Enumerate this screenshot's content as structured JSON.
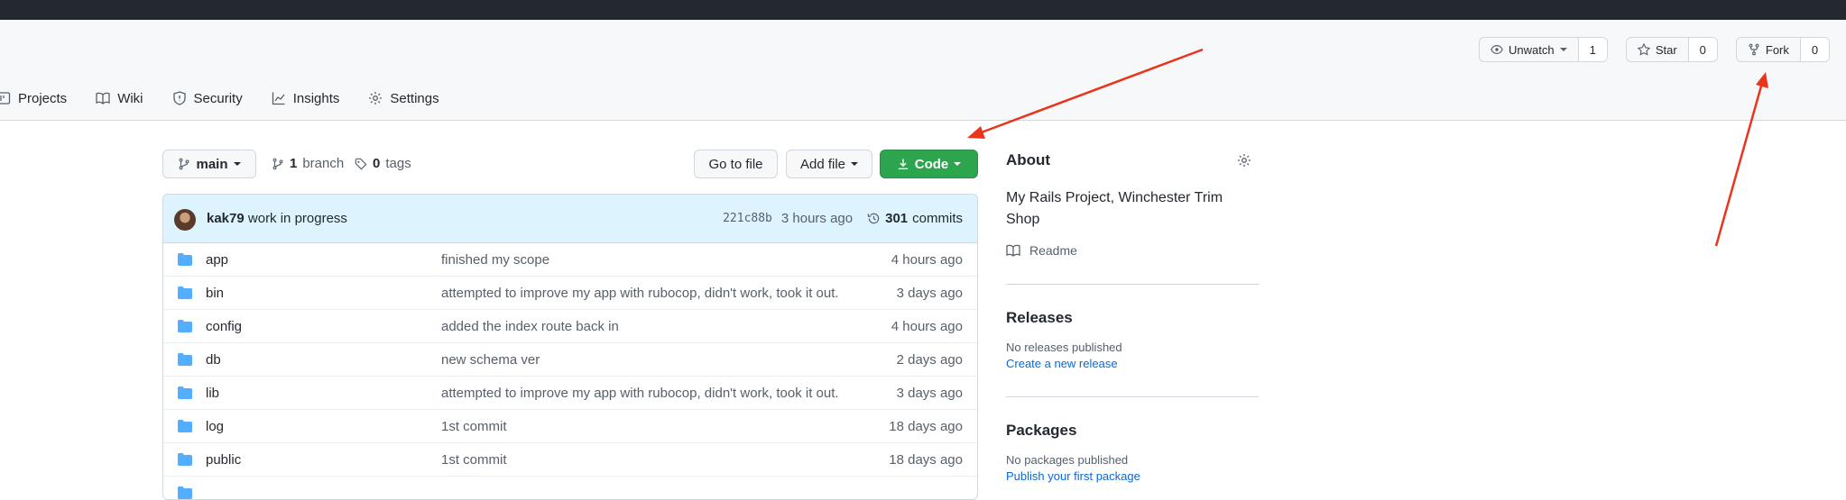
{
  "header": {
    "watch": {
      "label": "Unwatch",
      "count": "1"
    },
    "star": {
      "label": "Star",
      "count": "0"
    },
    "fork": {
      "label": "Fork",
      "count": "0"
    }
  },
  "nav": {
    "items": [
      {
        "label": "Projects",
        "icon": "project-icon"
      },
      {
        "label": "Wiki",
        "icon": "book-icon"
      },
      {
        "label": "Security",
        "icon": "shield-icon"
      },
      {
        "label": "Insights",
        "icon": "graph-icon"
      },
      {
        "label": "Settings",
        "icon": "gear-icon"
      }
    ]
  },
  "toolbar": {
    "branch": "main",
    "branch_count": "1",
    "branch_word": "branch",
    "tag_count": "0",
    "tag_word": "tags",
    "goto_file": "Go to file",
    "add_file": "Add file",
    "code": "Code"
  },
  "commit": {
    "author": "kak79",
    "message": "work in progress",
    "sha": "221c88b",
    "time": "3 hours ago",
    "count": "301",
    "count_word": "commits"
  },
  "files": [
    {
      "name": "app",
      "message": "finished my scope",
      "age": "4 hours ago"
    },
    {
      "name": "bin",
      "message": "attempted to improve my app with rubocop, didn't work, took it out.",
      "age": "3 days ago"
    },
    {
      "name": "config",
      "message": "added the index route back in",
      "age": "4 hours ago"
    },
    {
      "name": "db",
      "message": "new schema ver",
      "age": "2 days ago"
    },
    {
      "name": "lib",
      "message": "attempted to improve my app with rubocop, didn't work, took it out.",
      "age": "3 days ago"
    },
    {
      "name": "log",
      "message": "1st commit",
      "age": "18 days ago"
    },
    {
      "name": "public",
      "message": "1st commit",
      "age": "18 days ago"
    }
  ],
  "about": {
    "title": "About",
    "description": "My Rails Project, Winchester Trim Shop",
    "readme": "Readme"
  },
  "releases": {
    "title": "Releases",
    "empty": "No releases published",
    "link": "Create a new release"
  },
  "packages": {
    "title": "Packages",
    "empty": "No packages published",
    "link": "Publish your first package"
  },
  "colors": {
    "accent_green": "#2da44e",
    "link_blue": "#0969da",
    "annotation_red": "#e8351c",
    "folder_blue": "#54aeff"
  }
}
